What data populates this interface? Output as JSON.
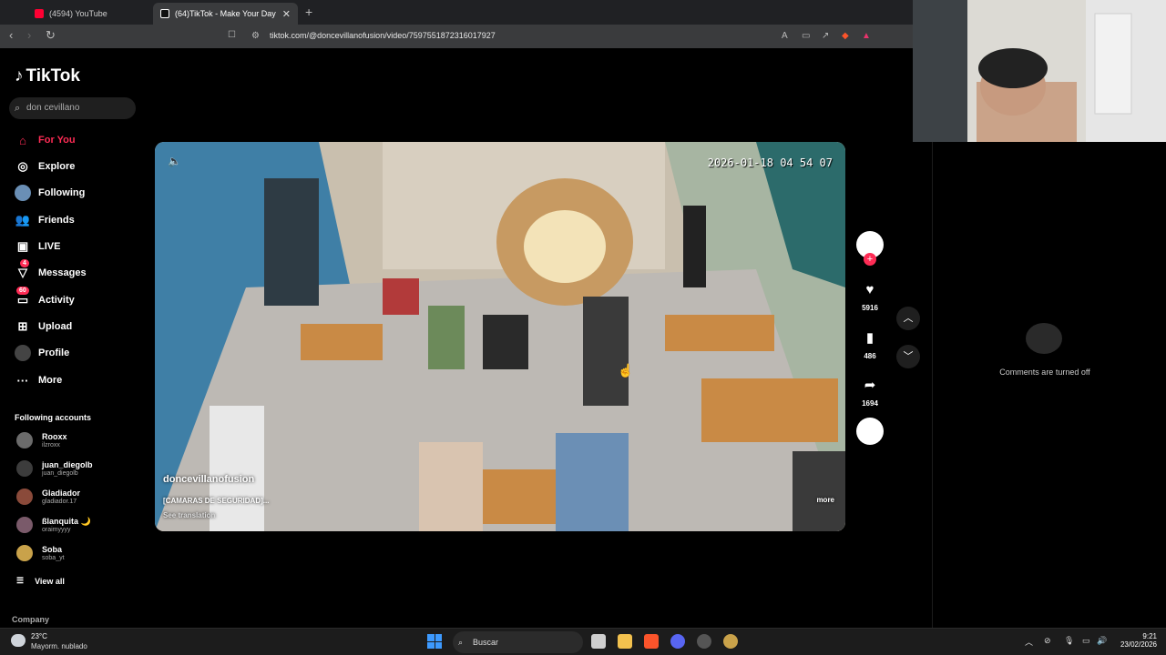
{
  "browser": {
    "tabs": [
      {
        "title": "(4594) YouTube",
        "color": "#ff0033"
      },
      {
        "title": "(64)TikTok - Make Your Day",
        "color": "#ffffff"
      }
    ],
    "url": "tiktok.com/@doncevillanofusion/video/7597551872316017927"
  },
  "sidebar": {
    "logo": "TikTok",
    "search_value": "don cevillano",
    "nav": [
      {
        "label": "For You",
        "icon": "home-icon",
        "active": true
      },
      {
        "label": "Explore",
        "icon": "compass-icon"
      },
      {
        "label": "Following",
        "icon": "following-avatar-icon"
      },
      {
        "label": "Friends",
        "icon": "friends-icon"
      },
      {
        "label": "LIVE",
        "icon": "live-icon"
      },
      {
        "label": "Messages",
        "icon": "messages-icon",
        "badge": "4"
      },
      {
        "label": "Activity",
        "icon": "activity-icon",
        "badge": "60"
      },
      {
        "label": "Upload",
        "icon": "upload-icon"
      },
      {
        "label": "Profile",
        "icon": "profile-icon"
      },
      {
        "label": "More",
        "icon": "more-icon"
      }
    ],
    "following_header": "Following accounts",
    "accounts": [
      {
        "name": "Rooxx",
        "handle": "ilzroxx"
      },
      {
        "name": "juan_diegolb",
        "handle": "juan_diegolb"
      },
      {
        "name": "Gladiador",
        "handle": "gladiador.17"
      },
      {
        "name": "ßlanquita 🌙",
        "handle": "oraimyyyy"
      },
      {
        "name": "Soba",
        "handle": "soba_yt"
      }
    ],
    "view_all": "View all",
    "company": "Company"
  },
  "video": {
    "timestamp": "2026-01-18 04 54 07",
    "author": "doncevillanofusion",
    "caption": "[CAMARAS DE SEGURIDAD]...",
    "translate": "See translation",
    "more": "more"
  },
  "actions": {
    "likes": "5916",
    "saves": "486",
    "shares": "1694"
  },
  "comments": {
    "message": "Comments are turned off"
  },
  "taskbar": {
    "temp": "23°C",
    "condition": "Mayorm. nublado",
    "search": "Buscar",
    "time": "9:21",
    "date": "23/02/2026"
  }
}
